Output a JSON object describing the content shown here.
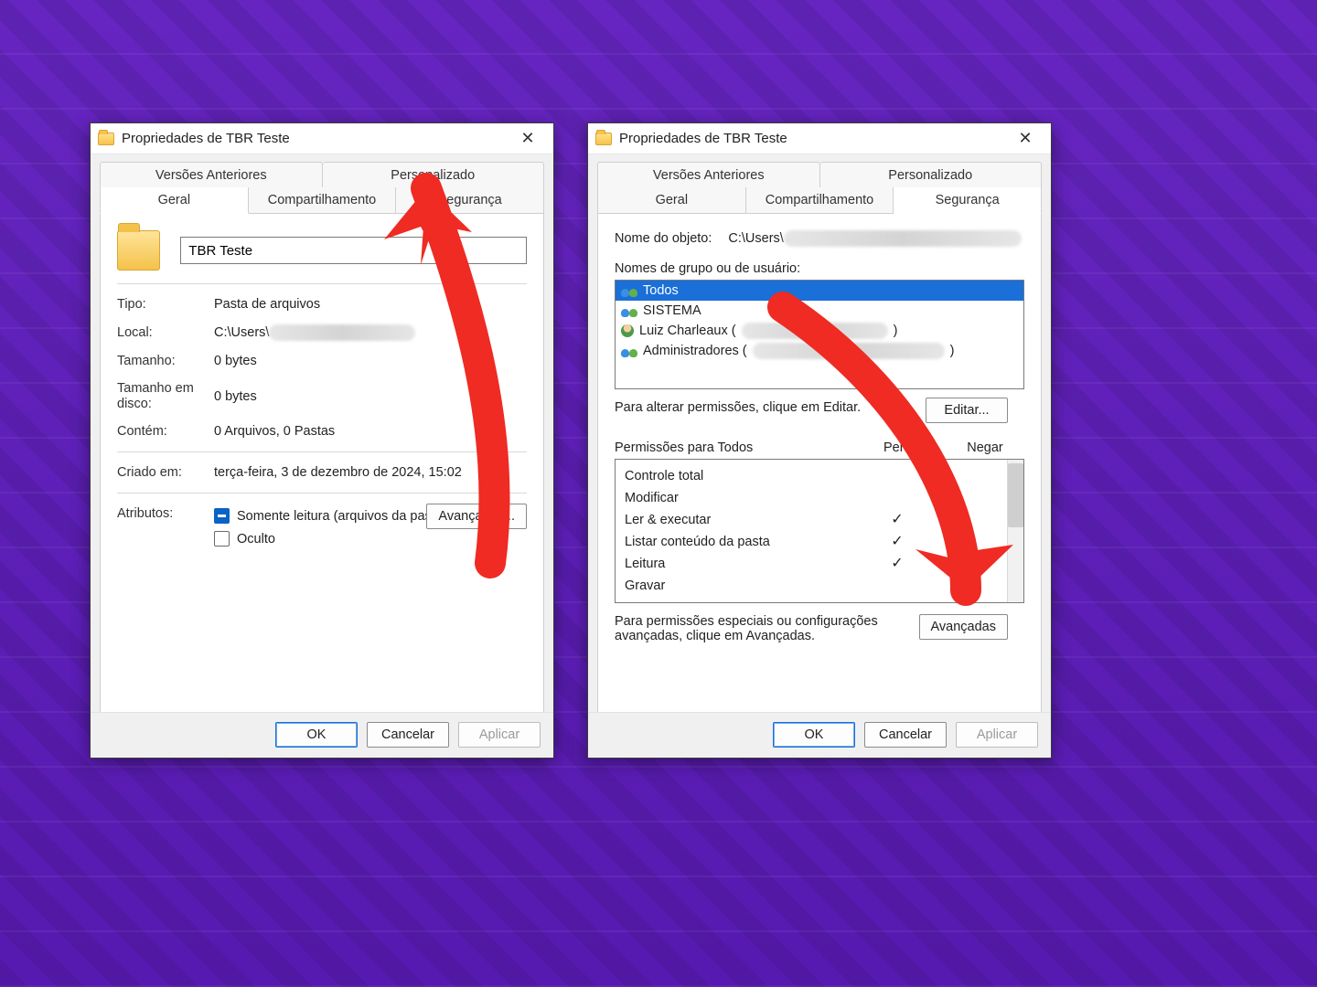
{
  "colors": {
    "accent": "#ef2b23",
    "select": "#1a6fd8",
    "bg": "#6a28c9"
  },
  "dialogA": {
    "title": "Propriedades de TBR Teste",
    "tabs_top": [
      "Versões Anteriores",
      "Personalizado"
    ],
    "tabs_bottom": [
      "Geral",
      "Compartilhamento",
      "Segurança"
    ],
    "active_tab": "Geral",
    "name_value": "TBR Teste",
    "rows": {
      "type_label": "Tipo:",
      "type_value": "Pasta de arquivos",
      "location_label": "Local:",
      "location_prefix": "C:\\Users\\",
      "size_label": "Tamanho:",
      "size_value": "0 bytes",
      "sizeondisk_label": "Tamanho em disco:",
      "sizeondisk_value": "0 bytes",
      "contains_label": "Contém:",
      "contains_value": "0 Arquivos, 0 Pastas",
      "created_label": "Criado em:",
      "created_value": "terça-feira, 3 de dezembro de 2024, 15:02",
      "attrs_label": "Atributos:",
      "readonly_label": "Somente leitura (arquivos da pasta)",
      "hidden_label": "Oculto",
      "advanced_button": "Avançados..."
    },
    "footer": {
      "ok": "OK",
      "cancel": "Cancelar",
      "apply": "Aplicar"
    }
  },
  "dialogB": {
    "title": "Propriedades de TBR Teste",
    "tabs_top": [
      "Versões Anteriores",
      "Personalizado"
    ],
    "tabs_bottom": [
      "Geral",
      "Compartilhamento",
      "Segurança"
    ],
    "active_tab": "Segurança",
    "object_label": "Nome do objeto:",
    "object_prefix": "C:\\Users\\",
    "groups_label": "Nomes de grupo ou de usuário:",
    "groups": [
      "Todos",
      "SISTEMA",
      "Luiz Charleaux (",
      "Administradores ("
    ],
    "edit_hint": "Para alterar permissões, clique em Editar.",
    "edit_button": "Editar...",
    "perm_header": "Permissões para Todos",
    "perm_allow": "Permitir",
    "perm_deny": "Negar",
    "perms": [
      {
        "name": "Controle total",
        "allow": false,
        "deny": false
      },
      {
        "name": "Modificar",
        "allow": false,
        "deny": false
      },
      {
        "name": "Ler & executar",
        "allow": true,
        "deny": false
      },
      {
        "name": "Listar conteúdo da pasta",
        "allow": true,
        "deny": false
      },
      {
        "name": "Leitura",
        "allow": true,
        "deny": false
      },
      {
        "name": "Gravar",
        "allow": false,
        "deny": false
      }
    ],
    "adv_hint": "Para permissões especiais ou configurações avançadas, clique em Avançadas.",
    "adv_button": "Avançadas",
    "footer": {
      "ok": "OK",
      "cancel": "Cancelar",
      "apply": "Aplicar"
    }
  }
}
